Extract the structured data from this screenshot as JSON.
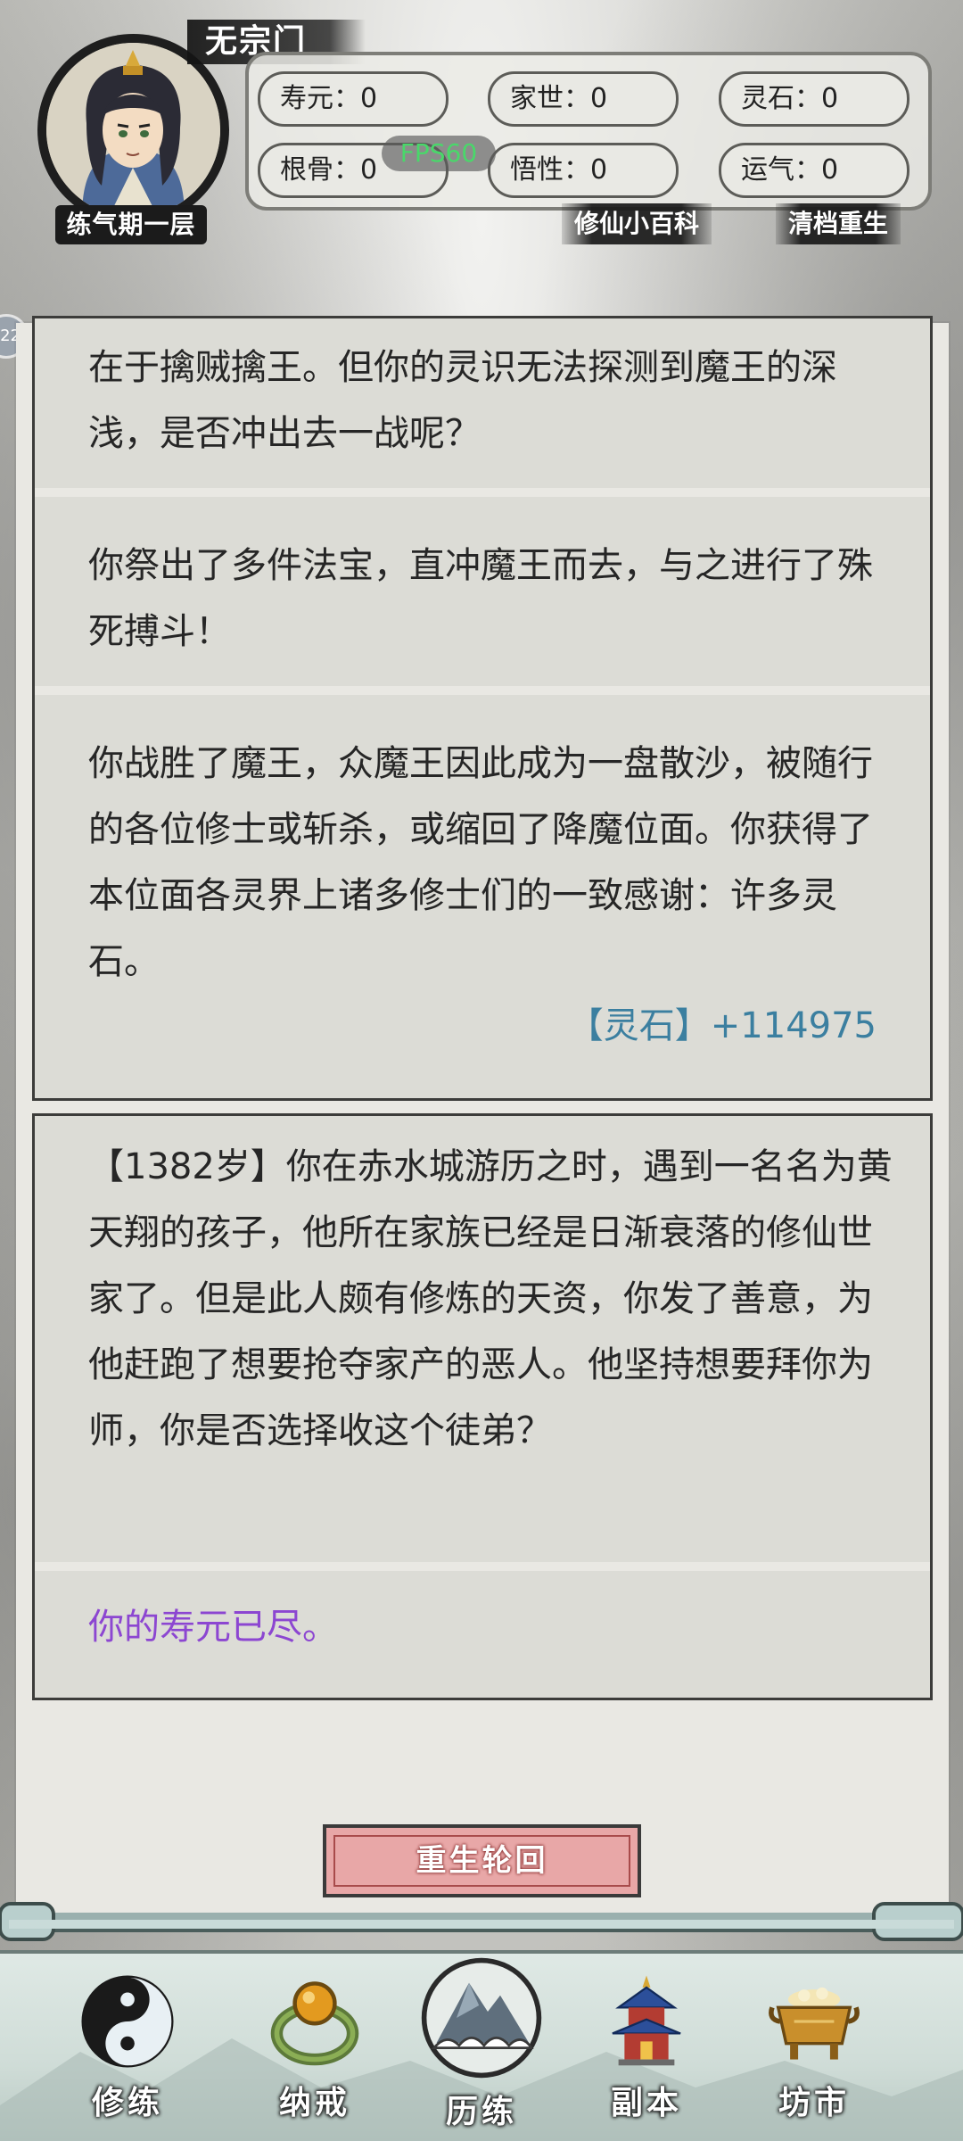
{
  "header": {
    "sect": "无宗门",
    "realm": "练气期一层",
    "fps": "FPS60",
    "stats": [
      {
        "label": "寿元：",
        "value": "0"
      },
      {
        "label": "家世：",
        "value": "0"
      },
      {
        "label": "灵石：",
        "value": "0"
      },
      {
        "label": "根骨：",
        "value": "0"
      },
      {
        "label": "悟性：",
        "value": "0"
      },
      {
        "label": "运气：",
        "value": "0"
      }
    ],
    "encyclopedia_label": "修仙小百科",
    "reset_label": "清档重生",
    "side_badge": "22"
  },
  "log": {
    "card1": {
      "entries": [
        "在于擒贼擒王。但你的灵识无法探测到魔王的深浅，是否冲出去一战呢？",
        "你祭出了多件法宝，直冲魔王而去，与之进行了殊死搏斗！",
        "你战胜了魔王，众魔王因此成为一盘散沙，被随行的各位修士或斩杀，或缩回了降魔位面。你获得了本位面各灵界上诸多修士们的一致感谢：许多灵石。"
      ],
      "reward": "【灵石】+114975"
    },
    "card2": {
      "entries": [
        "【1382岁】你在赤水城游历之时，遇到一名名为黄天翔的孩子，他所在家族已经是日渐衰落的修仙世家了。但是此人颇有修炼的天资，你发了善意，为他赶跑了想要抢夺家产的恶人。他坚持想要拜你为师，你是否选择收这个徒弟？",
        "你的寿元已尽。"
      ]
    }
  },
  "rebirth_button": "重生轮回",
  "nav": {
    "items": [
      {
        "label": "修练",
        "icon": "yin-yang-icon"
      },
      {
        "label": "纳戒",
        "icon": "ring-icon"
      },
      {
        "label": "历练",
        "icon": "mountain-cloud-icon"
      },
      {
        "label": "副本",
        "icon": "pagoda-icon"
      },
      {
        "label": "坊市",
        "icon": "cauldron-icon"
      }
    ]
  },
  "colors": {
    "reward_text": "#3b7fa0",
    "lifespan_text": "#8c46d1",
    "fps_text": "#49d86a",
    "rebirth_button": "#e8a7a7"
  }
}
